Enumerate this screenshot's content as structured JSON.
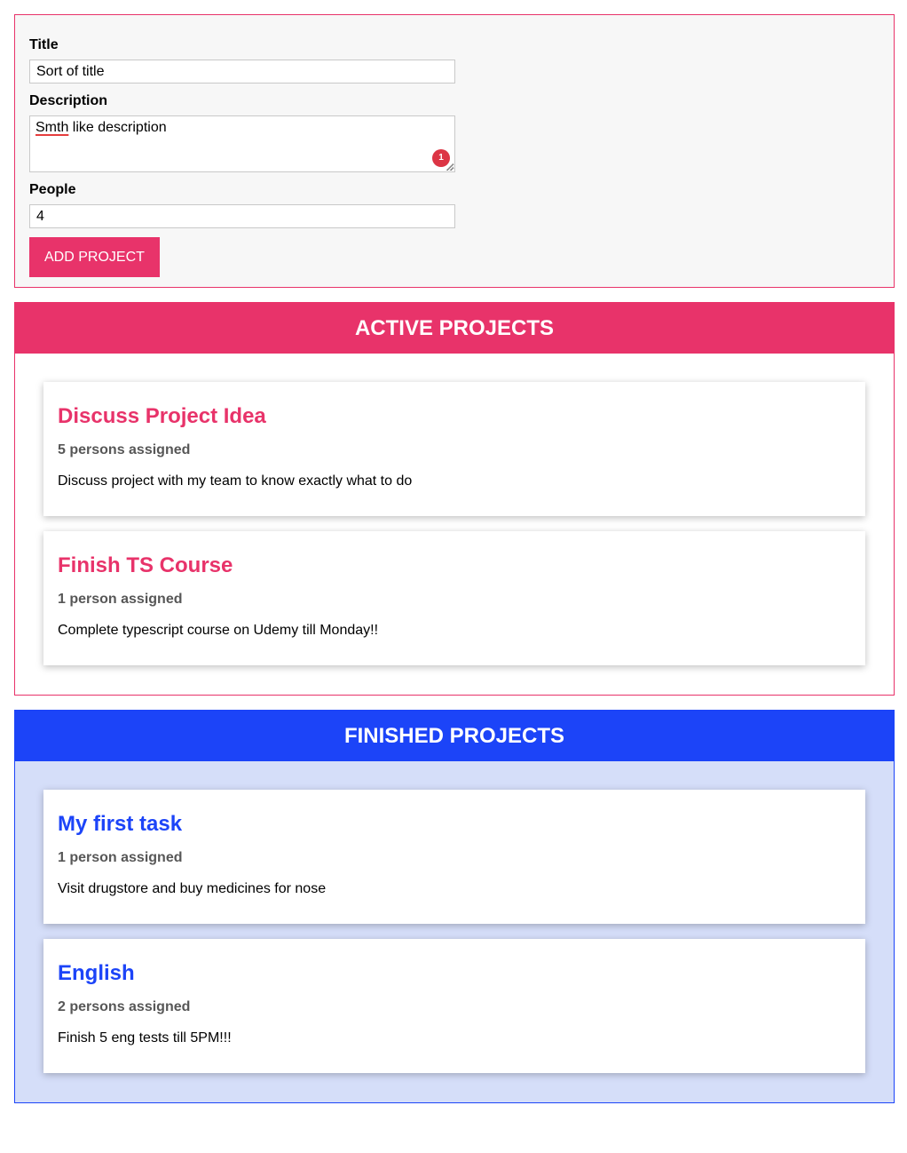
{
  "colors": {
    "accent_active": "#e8336a",
    "accent_finished": "#1c44f8",
    "finished_background": "#d5def9",
    "form_background": "#f7f7f7"
  },
  "form": {
    "title_label": "Title",
    "title_value": "Sort of title",
    "description_label": "Description",
    "description_misspelled_word": "Smth",
    "description_rest": " like description",
    "spellcheck_badge_count": "1",
    "people_label": "People",
    "people_value": "4",
    "submit_label": "ADD PROJECT"
  },
  "active_projects": {
    "heading": "ACTIVE PROJECTS",
    "items": [
      {
        "title": "Discuss Project Idea",
        "people": "5 persons assigned",
        "description": "Discuss project with my team to know exactly what to do"
      },
      {
        "title": "Finish TS Course",
        "people": "1 person assigned",
        "description": "Complete typescript course on Udemy till Monday!!"
      }
    ]
  },
  "finished_projects": {
    "heading": "FINISHED PROJECTS",
    "items": [
      {
        "title": "My first task",
        "people": "1 person assigned",
        "description": "Visit drugstore and buy medicines for nose"
      },
      {
        "title": "English",
        "people": "2 persons assigned",
        "description": "Finish 5 eng tests till 5PM!!!"
      }
    ]
  }
}
